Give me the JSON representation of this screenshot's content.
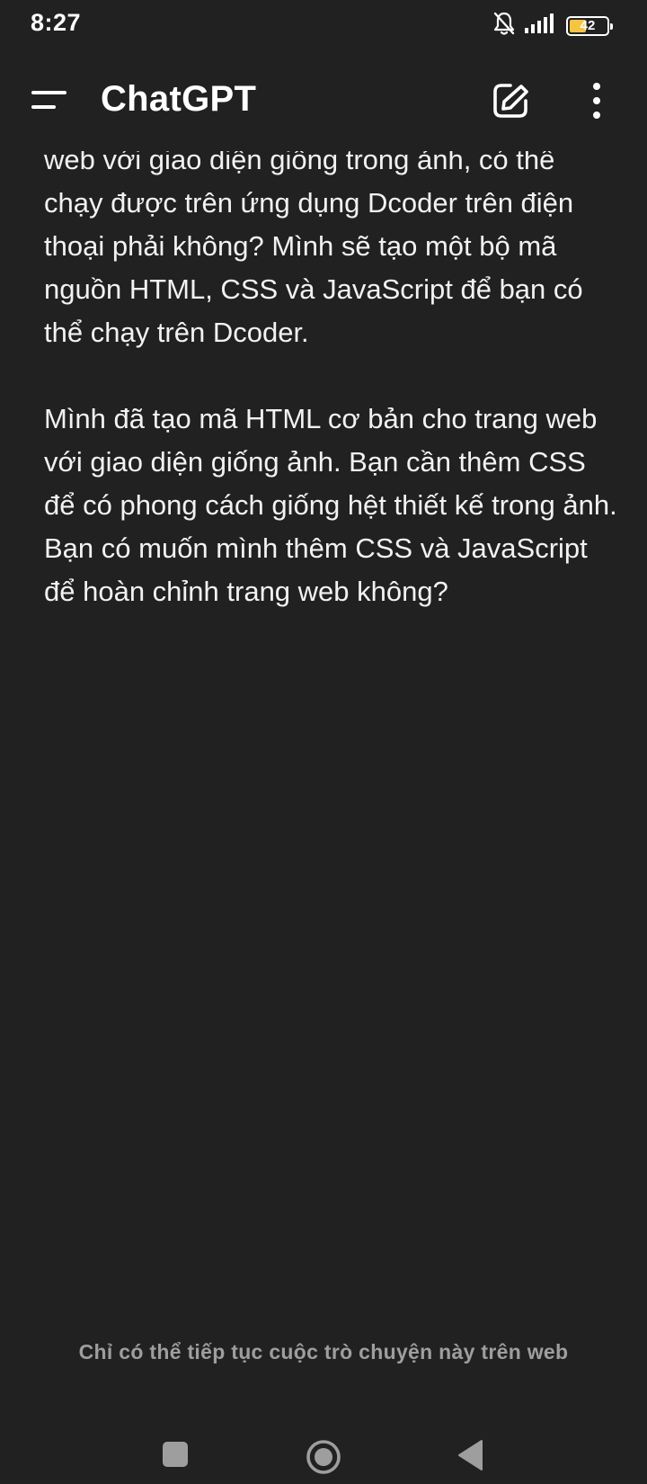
{
  "status_bar": {
    "time": "8:27",
    "battery_level": "42",
    "battery_color": "#f5c542",
    "icons": [
      "bell-muted-icon",
      "signal-icon",
      "battery-icon"
    ]
  },
  "header": {
    "title": "ChatGPT",
    "icons": [
      "menu-icon",
      "edit-icon",
      "more-vertical-icon"
    ]
  },
  "chat": {
    "paragraphs": [
      "web với giao diện giống trong ảnh, có thể chạy được trên ứng dụng Dcoder trên điện thoại phải không? Mình sẽ tạo một bộ mã nguồn HTML, CSS và JavaScript để bạn có thể chạy trên Dcoder.",
      "Mình đã tạo mã HTML cơ bản cho trang web với giao diện giống ảnh. Bạn cần thêm CSS để có phong cách giống hệt thiết kế trong ảnh. Bạn có muốn mình thêm CSS và JavaScript để hoàn chỉnh trang web không?"
    ]
  },
  "footer": {
    "note": "Chỉ có thể tiếp tục cuộc trò chuyện này trên web"
  },
  "nav": {
    "icons": [
      "recents-icon",
      "home-icon",
      "back-icon"
    ]
  },
  "colors": {
    "background": "#212121",
    "text": "#f2f2f2",
    "muted_text": "#9e9e9e"
  }
}
